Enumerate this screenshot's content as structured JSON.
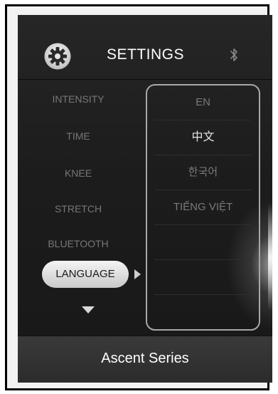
{
  "header": {
    "title": "SETTINGS",
    "settings_icon": "gear-icon",
    "status_icon": "bluetooth-icon"
  },
  "menu": {
    "items": [
      {
        "label": "INTENSITY"
      },
      {
        "label": "TIME"
      },
      {
        "label": "KNEE"
      },
      {
        "label": "STRETCH"
      },
      {
        "label": "BLUETOOTH"
      },
      {
        "label": "LANGUAGE",
        "selected": true
      }
    ],
    "scroll_indicator": "triangle-down-icon",
    "selection_indicator": "triangle-right-icon"
  },
  "language_panel": {
    "options": [
      {
        "label": "EN"
      },
      {
        "label": "中文",
        "highlighted": true
      },
      {
        "label": "한국어"
      },
      {
        "label": "TIẾNG VIỆT"
      }
    ]
  },
  "footer": {
    "label": "Ascent Series"
  }
}
